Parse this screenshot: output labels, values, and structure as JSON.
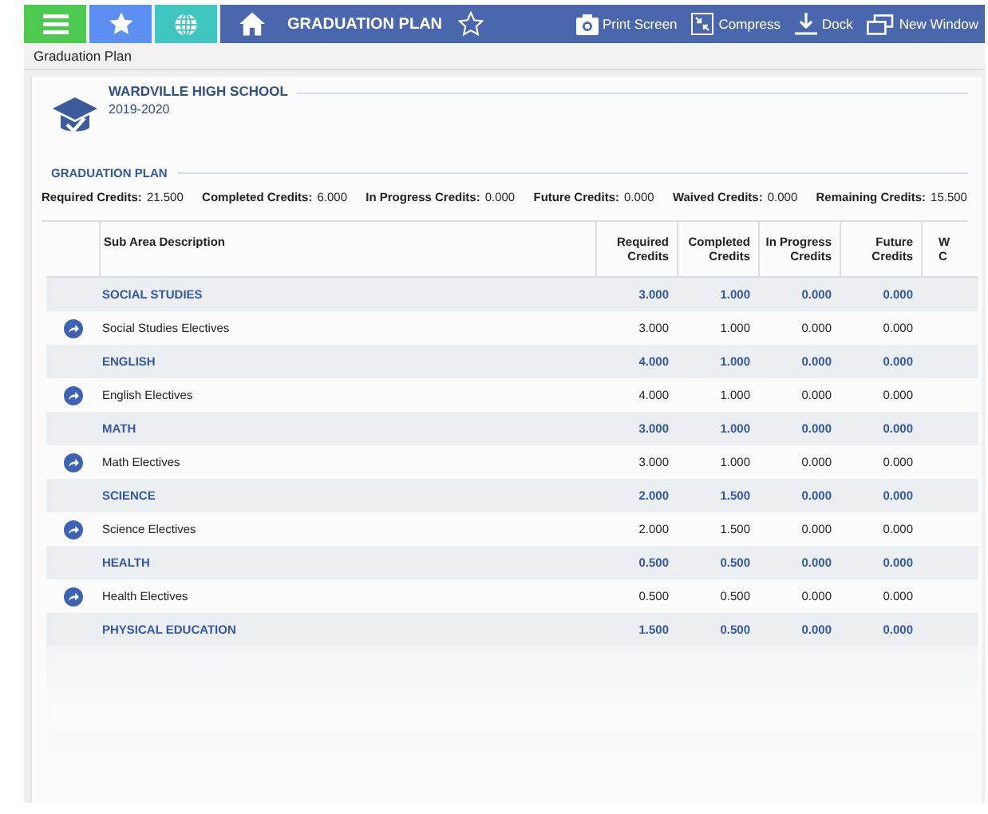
{
  "toolbar": {
    "title": "GRADUATION PLAN",
    "actions": [
      {
        "kind": "print",
        "label": "Print Screen"
      },
      {
        "kind": "compress",
        "label": "Compress"
      },
      {
        "kind": "dock",
        "label": "Dock"
      },
      {
        "kind": "window",
        "label": "New Window"
      }
    ]
  },
  "breadcrumb": "Graduation Plan",
  "school": {
    "name": "WARDVILLE HIGH SCHOOL",
    "year": "2019-2020"
  },
  "section_title": "GRADUATION PLAN",
  "summary": [
    {
      "label": "Required Credits:",
      "value": "21.500"
    },
    {
      "label": "Completed Credits:",
      "value": "6.000"
    },
    {
      "label": "In Progress Credits:",
      "value": "0.000"
    },
    {
      "label": "Future Credits:",
      "value": "0.000"
    },
    {
      "label": "Waived Credits:",
      "value": "0.000"
    },
    {
      "label": "Remaining Credits:",
      "value": "15.500"
    }
  ],
  "table": {
    "columns": [
      "Sub Area Description",
      "Required Credits",
      "Completed Credits",
      "In Progress Credits",
      "Future Credits",
      "W C"
    ],
    "rows": [
      {
        "kind": "area",
        "cells": [
          "SOCIAL STUDIES",
          "3.000",
          "1.000",
          "0.000",
          "0.000"
        ]
      },
      {
        "kind": "subarea",
        "cells": [
          "Social Studies Electives",
          "3.000",
          "1.000",
          "0.000",
          "0.000"
        ]
      },
      {
        "kind": "area",
        "cells": [
          "ENGLISH",
          "4.000",
          "1.000",
          "0.000",
          "0.000"
        ]
      },
      {
        "kind": "subarea",
        "cells": [
          "English Electives",
          "4.000",
          "1.000",
          "0.000",
          "0.000"
        ]
      },
      {
        "kind": "area",
        "cells": [
          "MATH",
          "3.000",
          "1.000",
          "0.000",
          "0.000"
        ]
      },
      {
        "kind": "subarea",
        "cells": [
          "Math Electives",
          "3.000",
          "1.000",
          "0.000",
          "0.000"
        ]
      },
      {
        "kind": "area",
        "cells": [
          "SCIENCE",
          "2.000",
          "1.500",
          "0.000",
          "0.000"
        ]
      },
      {
        "kind": "subarea",
        "cells": [
          "Science Electives",
          "2.000",
          "1.500",
          "0.000",
          "0.000"
        ]
      },
      {
        "kind": "area",
        "cells": [
          "HEALTH",
          "0.500",
          "0.500",
          "0.000",
          "0.000"
        ]
      },
      {
        "kind": "subarea",
        "cells": [
          "Health Electives",
          "0.500",
          "0.500",
          "0.000",
          "0.000"
        ]
      },
      {
        "kind": "area",
        "cells": [
          "PHYSICAL EDUCATION",
          "1.500",
          "0.500",
          "0.000",
          "0.000"
        ]
      }
    ]
  }
}
